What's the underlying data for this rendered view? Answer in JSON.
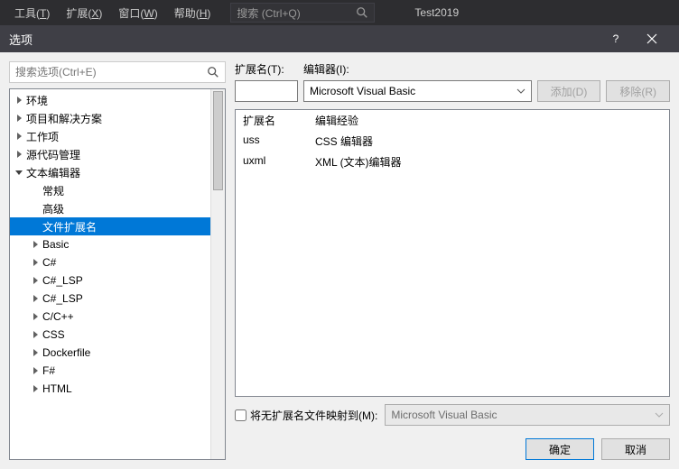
{
  "menubar": {
    "items": [
      {
        "label": "工具",
        "key": "T"
      },
      {
        "label": "扩展",
        "key": "X"
      },
      {
        "label": "窗口",
        "key": "W"
      },
      {
        "label": "帮助",
        "key": "H"
      }
    ],
    "search_placeholder": "搜索 (Ctrl+Q)",
    "tab": "Test2019"
  },
  "dialog": {
    "title": "选项",
    "search_placeholder": "搜索选项(Ctrl+E)"
  },
  "tree": [
    {
      "label": "环境",
      "depth": 0,
      "state": "collapsed"
    },
    {
      "label": "项目和解决方案",
      "depth": 0,
      "state": "collapsed"
    },
    {
      "label": "工作项",
      "depth": 0,
      "state": "collapsed"
    },
    {
      "label": "源代码管理",
      "depth": 0,
      "state": "collapsed"
    },
    {
      "label": "文本编辑器",
      "depth": 0,
      "state": "expanded"
    },
    {
      "label": "常规",
      "depth": 1,
      "state": "none"
    },
    {
      "label": "高级",
      "depth": 1,
      "state": "none"
    },
    {
      "label": "文件扩展名",
      "depth": 1,
      "state": "none",
      "selected": true
    },
    {
      "label": "Basic",
      "depth": 1,
      "state": "collapsed"
    },
    {
      "label": "C#",
      "depth": 1,
      "state": "collapsed"
    },
    {
      "label": "C#_LSP",
      "depth": 1,
      "state": "collapsed"
    },
    {
      "label": "C#_LSP",
      "depth": 1,
      "state": "collapsed"
    },
    {
      "label": "C/C++",
      "depth": 1,
      "state": "collapsed"
    },
    {
      "label": "CSS",
      "depth": 1,
      "state": "collapsed"
    },
    {
      "label": "Dockerfile",
      "depth": 1,
      "state": "collapsed"
    },
    {
      "label": "F#",
      "depth": 1,
      "state": "collapsed"
    },
    {
      "label": "HTML",
      "depth": 1,
      "state": "collapsed"
    }
  ],
  "form": {
    "ext_label": "扩展名(T):",
    "editor_label": "编辑器(I):",
    "editor_value": "Microsoft Visual Basic",
    "add_btn": "添加(D)",
    "remove_btn": "移除(R)"
  },
  "table": {
    "headers": [
      "扩展名",
      "编辑经验"
    ],
    "rows": [
      {
        "ext": "uss",
        "editor": "CSS 编辑器"
      },
      {
        "ext": "uxml",
        "editor": "XML (文本)编辑器"
      }
    ]
  },
  "map": {
    "checkbox_label": "将无扩展名文件映射到(M):",
    "value": "Microsoft Visual Basic"
  },
  "footer": {
    "ok": "确定",
    "cancel": "取消"
  }
}
